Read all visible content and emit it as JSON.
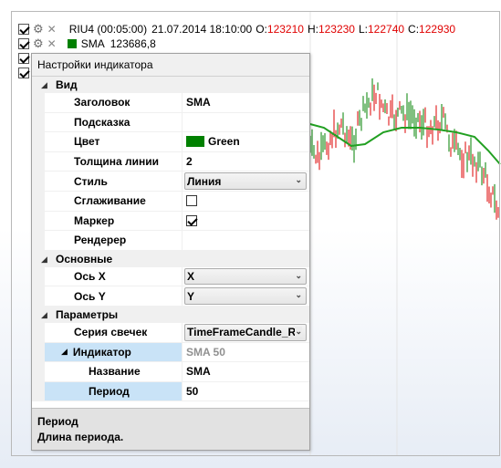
{
  "chart": {
    "title_line": {
      "symbol": "RIU4 (00:05:00)",
      "datetime": "21.07.2014 18:10:00",
      "o_label": "O:",
      "o_value": "123210",
      "h_label": "H:",
      "h_value": "123230",
      "l_label": "L:",
      "l_value": "122740",
      "c_label": "C:",
      "c_value": "122930"
    },
    "sma_line": {
      "label": "SMA",
      "value": "123686,8",
      "color": "#008000"
    },
    "colors": {
      "up": "#008000",
      "down": "#dd0000",
      "sma": "#22a022",
      "ohlc_values": "#e00000"
    }
  },
  "panel": {
    "title": "Настройки индикатора",
    "categories": {
      "view": "Вид",
      "main": "Основные",
      "params": "Параметры"
    },
    "rows": {
      "header": {
        "name": "Заголовок",
        "value": "SMA"
      },
      "tooltip": {
        "name": "Подсказка",
        "value": ""
      },
      "color": {
        "name": "Цвет",
        "value": "Green",
        "swatch": "#008000"
      },
      "thickness": {
        "name": "Толщина линии",
        "value": "2"
      },
      "style": {
        "name": "Стиль",
        "value": "Линия"
      },
      "smoothing": {
        "name": "Сглаживание",
        "checked": false
      },
      "marker": {
        "name": "Маркер",
        "checked": true
      },
      "renderer": {
        "name": "Рендерер",
        "value": ""
      },
      "axis_x": {
        "name": "Ось X",
        "value": "X"
      },
      "axis_y": {
        "name": "Ось Y",
        "value": "Y"
      },
      "candles": {
        "name": "Серия свечек",
        "value": "TimeFrameCandle_R"
      },
      "indicator": {
        "name": "Индикатор",
        "value": "SMA 50"
      },
      "ind_name": {
        "name": "Название",
        "value": "SMA"
      },
      "period": {
        "name": "Период",
        "value": "50"
      }
    },
    "description": {
      "title": "Период",
      "text": "Длина периода."
    }
  }
}
